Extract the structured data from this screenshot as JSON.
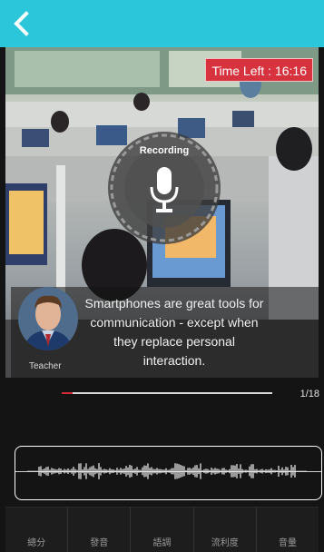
{
  "header": {
    "back_icon": "chevron-left-icon",
    "background_color": "#2cc6da"
  },
  "timer": {
    "label": "Time Left : 16:16",
    "color": "#d6333e"
  },
  "recorder": {
    "label": "Recording",
    "icon": "microphone-icon"
  },
  "teacher": {
    "label": "Teacher",
    "sentence": "Smartphones are great tools for communication - except when they replace personal interaction."
  },
  "progress": {
    "fraction": 0.05,
    "count_text": "1/18",
    "color": "#d22a36"
  },
  "score_tabs": [
    {
      "label": "總分"
    },
    {
      "label": "發音"
    },
    {
      "label": "語調"
    },
    {
      "label": "流利度"
    },
    {
      "label": "音量"
    }
  ]
}
